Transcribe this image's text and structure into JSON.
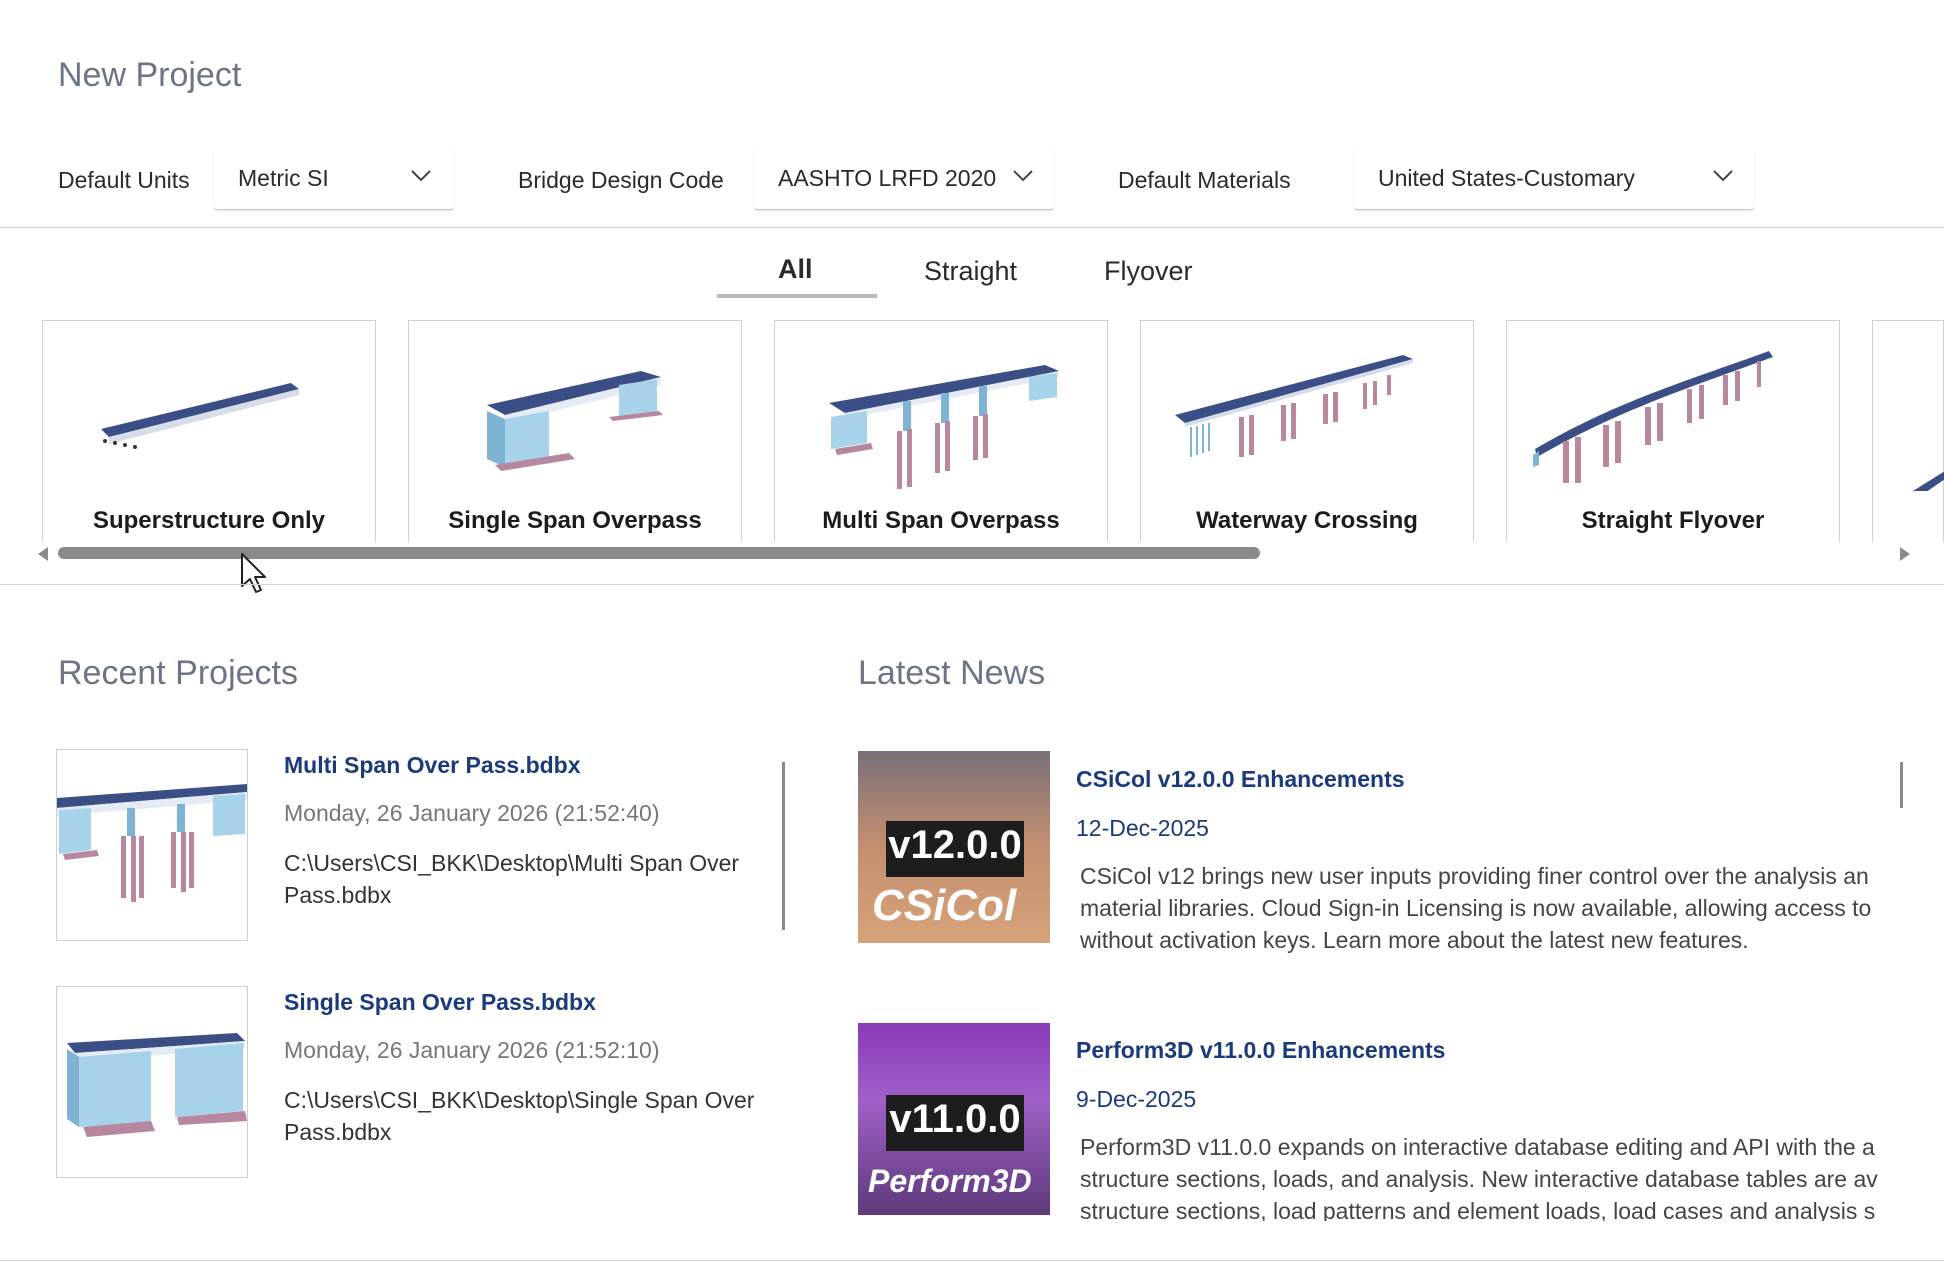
{
  "header": {
    "title": "New Project"
  },
  "settings": {
    "units_label": "Default Units",
    "units_value": "Metric SI",
    "code_label": "Bridge Design Code",
    "code_value": "AASHTO LRFD 2020",
    "materials_label": "Default Materials",
    "materials_value": "United States-Customary"
  },
  "tabs": [
    {
      "label": "All",
      "selected": true
    },
    {
      "label": "Straight",
      "selected": false
    },
    {
      "label": "Flyover",
      "selected": false
    }
  ],
  "templates": [
    {
      "label": "Superstructure Only",
      "icon": "superstructure-bridge-thumbnail"
    },
    {
      "label": "Single Span Overpass",
      "icon": "single-span-bridge-thumbnail"
    },
    {
      "label": "Multi Span Overpass",
      "icon": "multi-span-bridge-thumbnail"
    },
    {
      "label": "Waterway Crossing",
      "icon": "waterway-bridge-thumbnail"
    },
    {
      "label": "Straight Flyover",
      "icon": "flyover-bridge-thumbnail"
    }
  ],
  "recent": {
    "title": "Recent Projects",
    "items": [
      {
        "name": "Multi Span Over Pass.bdbx",
        "date": "Monday, 26 January 2026 (21:52:40)",
        "path": "C:\\Users\\CSI_BKK\\Desktop\\Multi Span Over Pass.bdbx"
      },
      {
        "name": "Single Span Over Pass.bdbx",
        "date": "Monday, 26 January 2026 (21:52:10)",
        "path": "C:\\Users\\CSI_BKK\\Desktop\\Single Span Over Pass.bdbx"
      }
    ]
  },
  "news": {
    "title": "Latest News",
    "items": [
      {
        "title": "CSiCol v12.0.0 Enhancements",
        "date": "12-Dec-2025",
        "thumb_version": "v12.0.0",
        "thumb_brand": "CSiCol",
        "body1": "CSiCol v12 brings new user inputs providing finer control over the analysis an",
        "body2": "material libraries. Cloud Sign-in Licensing is now available, allowing access to",
        "body3": "without activation keys. Learn more about the latest new features."
      },
      {
        "title": "Perform3D v11.0.0 Enhancements",
        "date": "9-Dec-2025",
        "thumb_version": "v11.0.0",
        "thumb_brand": "Perform3D",
        "body1": "Perform3D v11.0.0 expands on interactive database editing and API with the a",
        "body2": "structure sections, loads, and analysis. New interactive database tables are av",
        "body3": "structure sections, load patterns and element loads, load cases and analysis s"
      }
    ]
  },
  "colors": {
    "link": "#1a3a7a",
    "deck": "#3b4f86",
    "pier": "#a6d2ea",
    "pile": "#b6879e"
  }
}
